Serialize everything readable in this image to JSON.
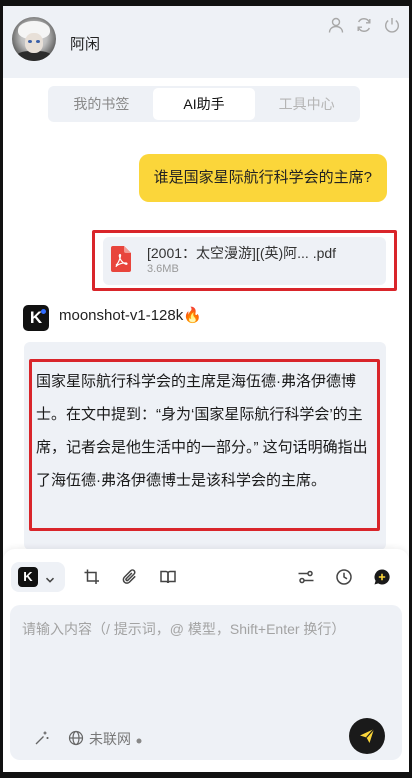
{
  "header": {
    "username": "阿闲",
    "icons": [
      "user-icon",
      "refresh-icon",
      "power-icon"
    ]
  },
  "tabs": [
    {
      "label": "我的书签"
    },
    {
      "label": "AI助手"
    },
    {
      "label": "工具中心"
    }
  ],
  "chat": {
    "question": "谁是国家星际航行科学会的主席?",
    "file": {
      "name": "[2001：太空漫游][(英)阿...  .pdf",
      "size": "3.6MB"
    },
    "bot": {
      "model": "moonshot-v1-128k",
      "badge": "🔥",
      "logo_letter": "K"
    },
    "answer": "国家星际航行科学会的主席是海伍德·弗洛伊德博士。在文中提到：“身为‘国家星际航行科学会’的主席，记者会是他生活中的一部分。” 这句话明确指出了海伍德·弗洛伊德博士是该科学会的主席。"
  },
  "composer": {
    "model_logo_letter": "K",
    "placeholder": "请输入内容（/ 提示词，@ 模型，Shift+Enter 换行）",
    "value": "",
    "network_label": "未联网"
  },
  "colors": {
    "accent_yellow": "#fbd63a",
    "highlight_red": "#d9252a",
    "panel_bg": "#eef1f6",
    "pdf_red": "#e8453c"
  }
}
